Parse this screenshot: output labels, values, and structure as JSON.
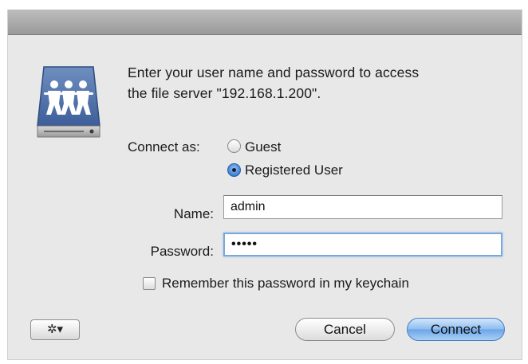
{
  "dialog": {
    "prompt_line1": "Enter your user name and password to access",
    "prompt_line2": "the file server \"192.168.1.200\".",
    "connect_as_label": "Connect as:",
    "radio_guest_label": "Guest",
    "radio_registered_label": "Registered User",
    "selected_connect_as": "Registered User",
    "name_label": "Name:",
    "name_value": "admin",
    "password_label": "Password:",
    "password_masked": "•••••",
    "remember_label": "Remember this password in my keychain",
    "remember_checked": false,
    "action_button_label": "✲▾",
    "cancel_label": "Cancel",
    "connect_label": "Connect"
  },
  "icons": {
    "server": "file-server-icon",
    "action": "gear-icon"
  },
  "colors": {
    "dialog_background": "#e8e8e8",
    "titlebar": "#a9a9a9",
    "default_button": "#7db2ef",
    "focus_ring": "#7ba7de"
  }
}
